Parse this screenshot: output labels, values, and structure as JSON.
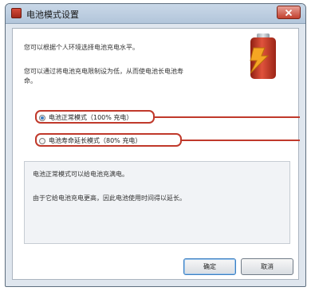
{
  "window": {
    "title": "电池模式设置",
    "app_icon": "battery-app-icon",
    "close_icon": "close-icon"
  },
  "content": {
    "intro_line1": "您可以根据个人环境选择电池充电水平。",
    "intro_line2a": "您可以通过将电池充电限制设为低，从而使电池长电池寿",
    "intro_line2b": "命。",
    "battery_icon": "battery-charging-icon",
    "battery_colors": {
      "body": "#c0392b",
      "bolt": "#f39c12"
    },
    "options": [
      {
        "label": "电池正常模式（100% 充电）",
        "checked": true
      },
      {
        "label": "电池寿命延长模式（80% 充电）",
        "checked": false
      }
    ],
    "highlight_color": "#c0392b",
    "description_line1": "电池正常模式可以给电池充满电。",
    "description_line2": "由于它给电池充电更高，因此电池使用时间得以延长。"
  },
  "buttons": {
    "ok": "确定",
    "cancel": "取消"
  }
}
